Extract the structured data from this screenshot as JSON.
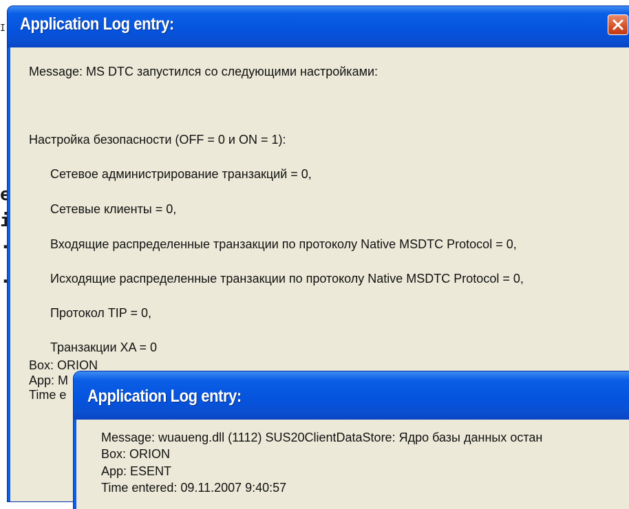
{
  "background": {
    "top_fragment": "I",
    "side_fragments": [
      "e",
      "i",
      ".",
      "."
    ]
  },
  "window1": {
    "title": "Application Log entry:",
    "close_icon": "close-icon",
    "lines": [
      "Message: MS DTC запустился со следующими настройками:",
      "Настройка безопасности (OFF = 0 и ON = 1):",
      "Сетевое администрирование транзакций = 0,",
      "Сетевые клиенты = 0,",
      "Входящие распределенные транзакции по протоколу Native MSDTC Protocol = 0,",
      "Исходящие распределенные транзакции по протоколу Native MSDTC Protocol = 0,",
      "Протокол TIP = 0,",
      "Транзакции XA = 0",
      "Box: ORION",
      "App: M",
      "Time e"
    ]
  },
  "window2": {
    "title": "Application Log entry:",
    "lines": [
      "Message: wuaueng.dll (1112) SUS20ClientDataStore: Ядро базы данных остан",
      "Box: ORION",
      "App: ESENT",
      "Time entered: 09.11.2007 9:40:57"
    ]
  },
  "colors": {
    "titlebar": "#0553dd",
    "window_body": "#ece9d8",
    "close_button": "#d4502a"
  }
}
